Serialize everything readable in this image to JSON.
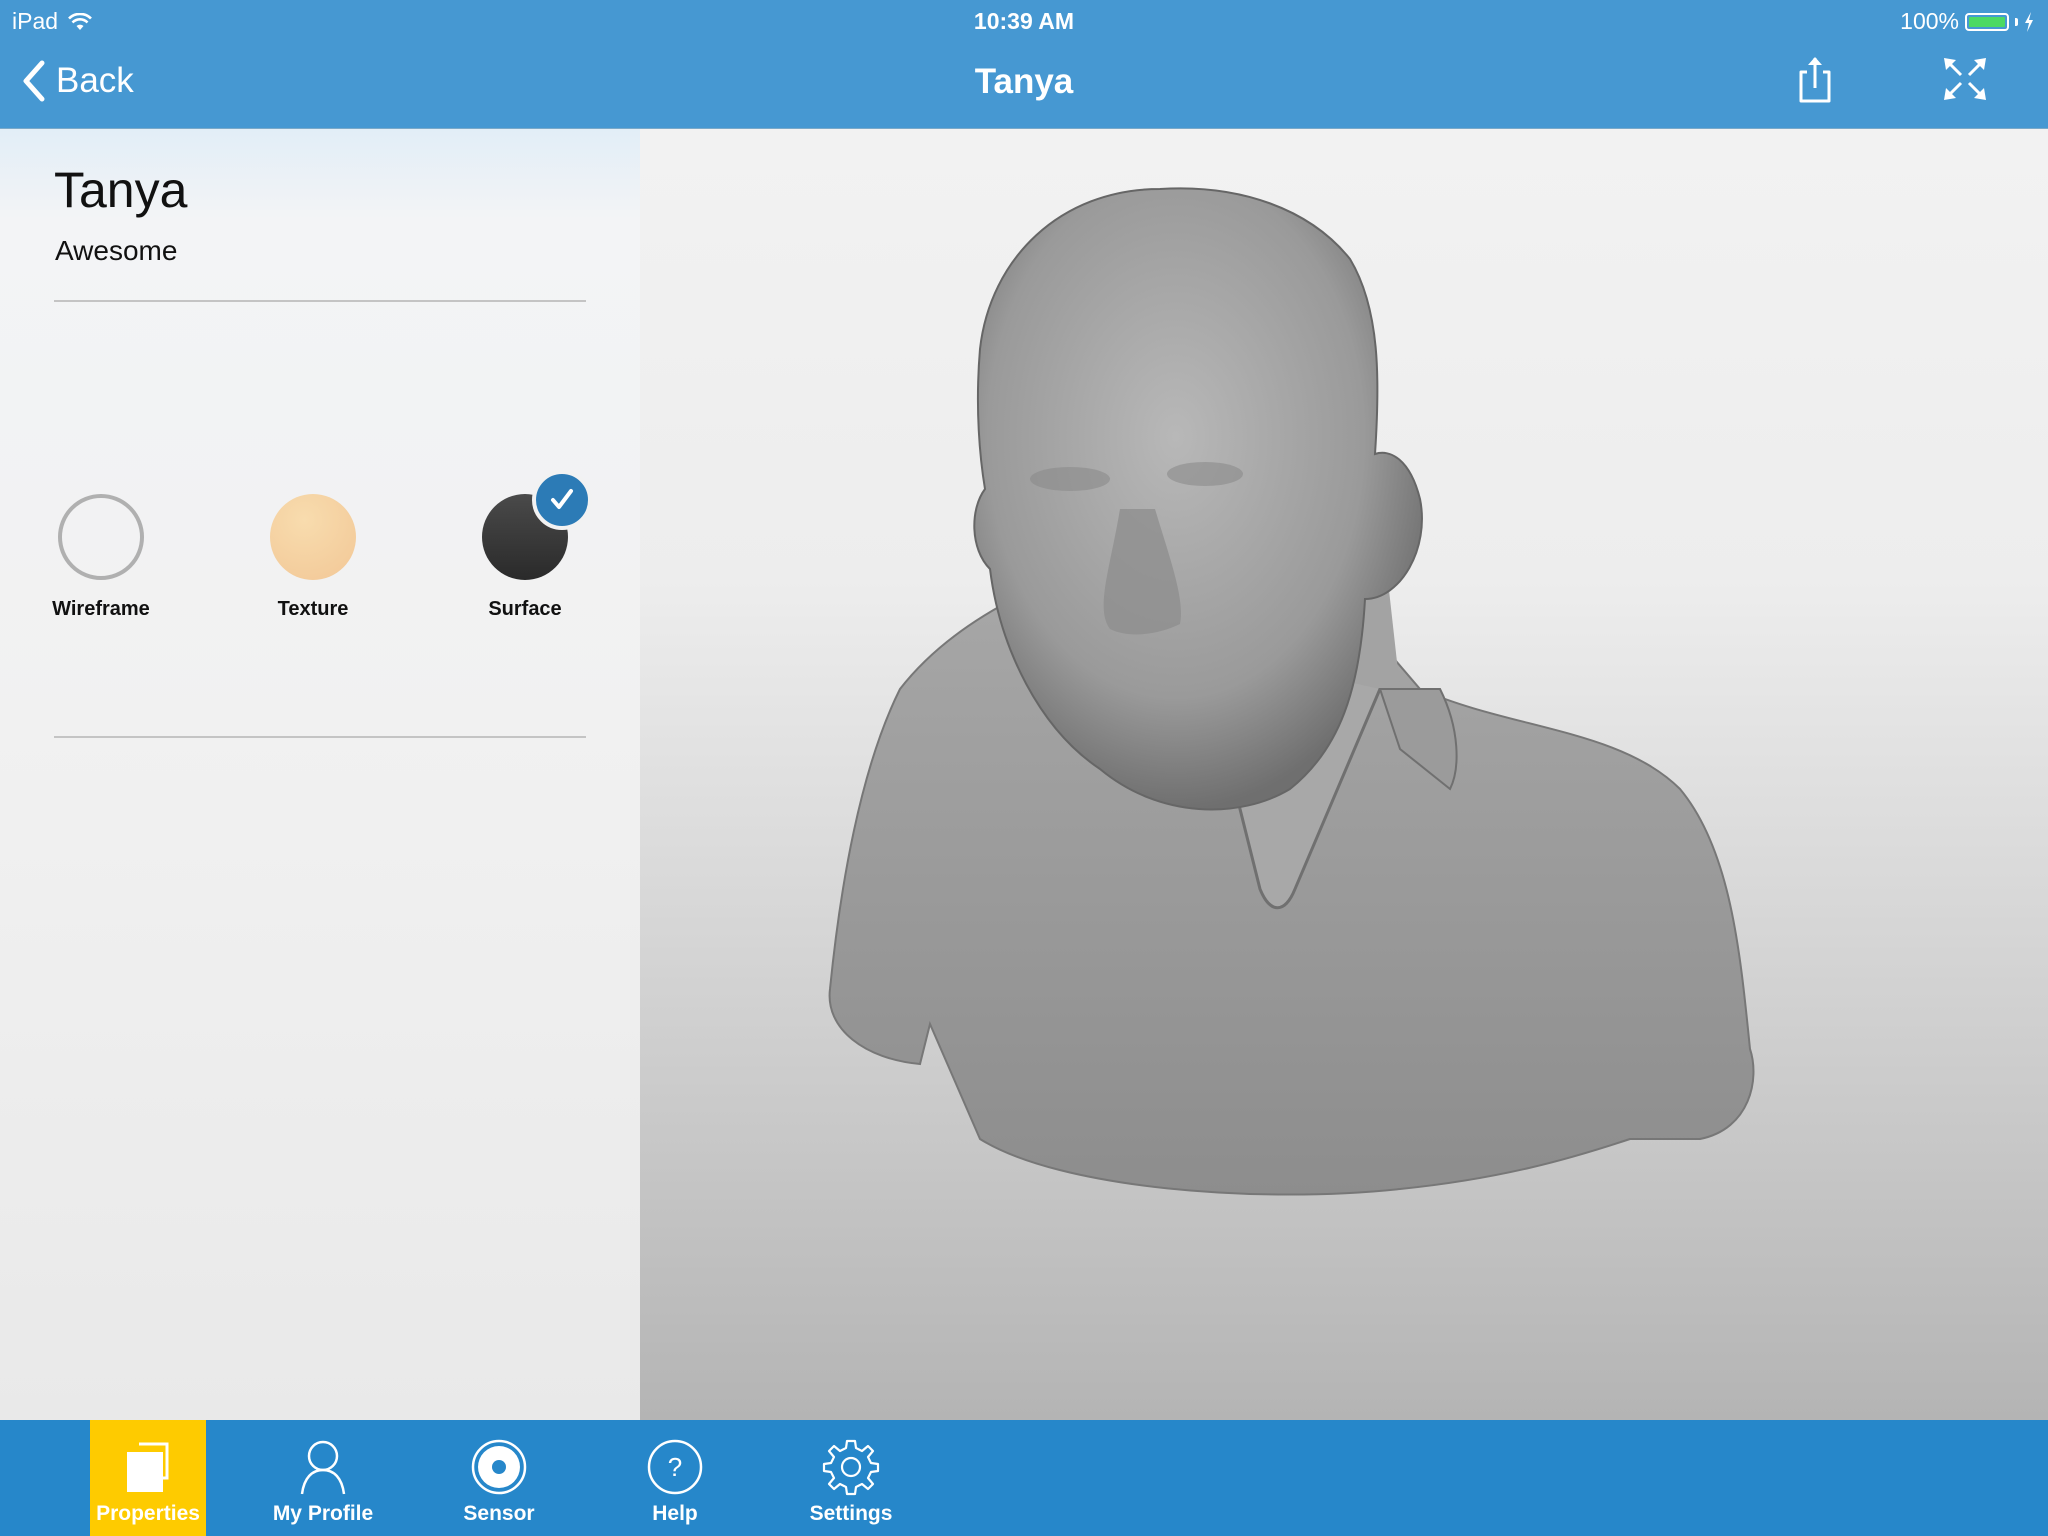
{
  "status_bar": {
    "carrier": "iPad",
    "time": "10:39 AM",
    "battery": "100%",
    "battery_color": "#4cd964"
  },
  "nav": {
    "back_label": "Back",
    "title": "Tanya",
    "actions": [
      "share-icon",
      "fullscreen-expand-icon"
    ]
  },
  "properties": {
    "name": "Tanya",
    "subtitle": "Awesome",
    "render_modes": [
      {
        "label": "Wireframe",
        "icon": "wireframe-swatch",
        "selected": false
      },
      {
        "label": "Texture",
        "icon": "texture-swatch",
        "selected": false
      },
      {
        "label": "Surface",
        "icon": "surface-swatch",
        "selected": true
      }
    ]
  },
  "viewer": {
    "content": "3D scanned bust model (surface render)"
  },
  "tabbar": {
    "active_color": "#fecb00",
    "bar_color": "#2687ca",
    "tabs": [
      {
        "label": "Properties",
        "icon": "properties-icon",
        "active": true
      },
      {
        "label": "My Profile",
        "icon": "profile-icon",
        "active": false
      },
      {
        "label": "Sensor",
        "icon": "sensor-icon",
        "active": false
      },
      {
        "label": "Help",
        "icon": "help-icon",
        "active": false
      },
      {
        "label": "Settings",
        "icon": "gear-icon",
        "active": false
      }
    ]
  }
}
